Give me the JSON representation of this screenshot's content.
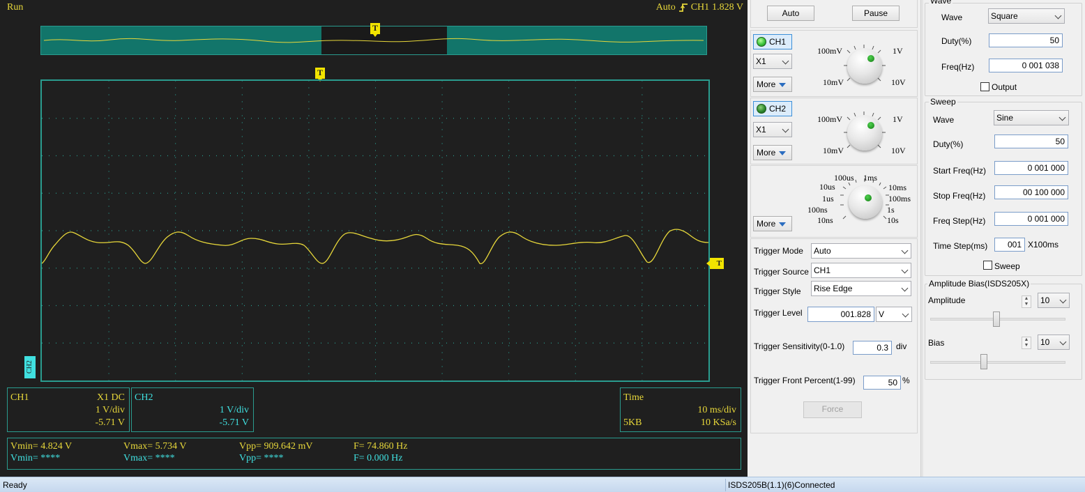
{
  "scope": {
    "run_state": "Run",
    "trigger_status": {
      "mode": "Auto",
      "channel": "CH1",
      "level": "1.828 V"
    },
    "marker_trigger": "T",
    "marker_ch2": "CH2",
    "colors": {
      "ch1": "#e7d73a",
      "ch2": "#40e0e0",
      "grid": "#2a9c8f",
      "background": "#1f1f1f"
    },
    "ch1_info": {
      "name": "CH1",
      "probe_coupling": "X1  DC",
      "scale": "1 V/div",
      "offset": "-5.71 V"
    },
    "ch2_info": {
      "name": "CH2",
      "scale": "1 V/div",
      "offset": "-5.71 V"
    },
    "time_info": {
      "label": "Time",
      "timebase": "10 ms/div",
      "depth": "5KB",
      "sample_rate": "10 KSa/s"
    },
    "measurements": {
      "ch1": {
        "vmin": "Vmin= 4.824 V",
        "vmax": "Vmax= 5.734 V",
        "vpp": "Vpp= 909.642 mV",
        "freq": "F= 74.860 Hz"
      },
      "ch2": {
        "vmin": "Vmin= ****",
        "vmax": "Vmax= ****",
        "vpp": "Vpp= ****",
        "freq": "F= 0.000 Hz"
      }
    }
  },
  "controls": {
    "auto_label": "Auto",
    "pause_label": "Pause",
    "ch1": {
      "label": "CH1",
      "probe": "X1",
      "more": "More",
      "knob_labels": [
        "100mV",
        "1V",
        "10mV",
        "10V"
      ]
    },
    "ch2": {
      "label": "CH2",
      "probe": "X1",
      "more": "More",
      "knob_labels": [
        "100mV",
        "1V",
        "10mV",
        "10V"
      ]
    },
    "timebase": {
      "more": "More",
      "knob_labels": [
        "100us",
        "1ms",
        "10us",
        "10ms",
        "1us",
        "100ms",
        "100ns",
        "1s",
        "10ns",
        "10s"
      ]
    },
    "trigger": {
      "mode_label": "Trigger Mode",
      "mode_value": "Auto",
      "source_label": "Trigger Source",
      "source_value": "CH1",
      "style_label": "Trigger Style",
      "style_value": "Rise Edge",
      "level_label": "Trigger Level",
      "level_value": "001.828",
      "level_unit": "V",
      "sensitivity_label": "Trigger Sensitivity(0-1.0)",
      "sensitivity_value": "0.3",
      "sensitivity_unit": "div",
      "front_label": "Trigger Front Percent(1-99)",
      "front_value": "50",
      "front_unit": "%",
      "force_label": "Force"
    }
  },
  "generator": {
    "wave_group": {
      "legend": "Wave",
      "wave_label": "Wave",
      "wave_value": "Square",
      "duty_label": "Duty(%)",
      "duty_value": "50",
      "freq_label": "Freq(Hz)",
      "freq_value": "0 001 038",
      "output_label": "Output"
    },
    "sweep_group": {
      "legend": "Sweep",
      "wave_label": "Wave",
      "wave_value": "Sine",
      "duty_label": "Duty(%)",
      "duty_value": "50",
      "start_label": "Start Freq(Hz)",
      "start_value": "0 001 000",
      "stop_label": "Stop Freq(Hz)",
      "stop_value": "00 100 000",
      "step_label": "Freq Step(Hz)",
      "step_value": "0 001 000",
      "time_label": "Time Step(ms)",
      "time_value": "001",
      "time_unit": "X100ms",
      "sweep_label": "Sweep"
    },
    "bias_group": {
      "legend": "Amplitude Bias(ISDS205X)",
      "amplitude_label": "Amplitude",
      "amplitude_value": "10",
      "bias_label": "Bias",
      "bias_value": "10"
    }
  },
  "status_bar": {
    "left": "Ready",
    "right": "ISDS205B(1.1)(6)Connected"
  }
}
